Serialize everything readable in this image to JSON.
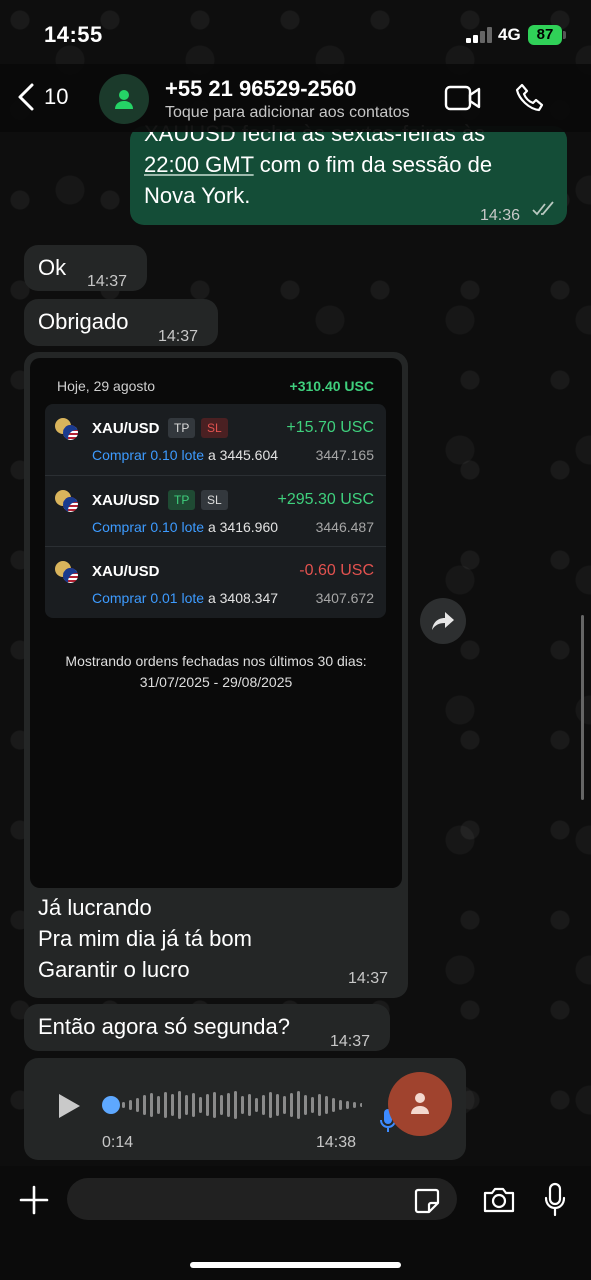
{
  "status_bar": {
    "time": "14:55",
    "network": "4G",
    "battery": "87"
  },
  "header": {
    "back_count": "10",
    "contact_name": "+55 21 96529-2560",
    "subtitle": "Toque para adicionar aos contatos"
  },
  "messages": {
    "out1": {
      "lines": [
        "XAUUSD fecha às sextas-feiras às",
        "22:00 GMT com o fim da sessão de",
        "Nova York."
      ],
      "time": "14:36"
    },
    "in_ok": {
      "text": "Ok",
      "time": "14:37"
    },
    "in_obrigado": {
      "text": "Obrigado",
      "time": "14:37"
    },
    "image_msg": {
      "caption": [
        "Já lucrando",
        "Pra mim dia já tá bom",
        "Garantir o lucro"
      ],
      "time": "14:37"
    },
    "in_segunda": {
      "text": "Então agora só segunda?",
      "time": "14:37"
    },
    "voice": {
      "duration": "0:14",
      "time": "14:38"
    }
  },
  "screenshot": {
    "date": "Hoje, 29 agosto",
    "total": "+310.40 USC",
    "orders": [
      {
        "symbol": "XAU/USD",
        "tags": [
          "TP",
          "SL"
        ],
        "pl": "+15.70 USC",
        "action": "Comprar 0.10 lote",
        "open_price": "a 3445.604",
        "close_price": "3447.165"
      },
      {
        "symbol": "XAU/USD",
        "tags": [
          "TP",
          "SL"
        ],
        "pl": "+295.30 USC",
        "action": "Comprar 0.10 lote",
        "open_price": "a 3416.960",
        "close_price": "3446.487"
      },
      {
        "symbol": "XAU/USD",
        "tags": [],
        "pl": "-0.60 USC",
        "action": "Comprar 0.01 lote",
        "open_price": "a 3408.347",
        "close_price": "3407.672"
      }
    ],
    "note_line1": "Mostrando ordens fechadas nos últimos 30 dias:",
    "note_line2": "31/07/2025 - 29/08/2025"
  },
  "input": {
    "placeholder": ""
  },
  "colors": {
    "outgoing": "#144d37",
    "incoming": "#242626",
    "profit": "#3fd07d",
    "loss": "#e2524f",
    "link": "#3d9bff"
  },
  "icons": [
    "back-chevron-icon",
    "contact-avatar-icon",
    "video-call-icon",
    "phone-icon",
    "double-check-icon",
    "forward-icon",
    "play-icon",
    "microphone-icon",
    "plus-icon",
    "sticker-icon",
    "camera-icon"
  ]
}
